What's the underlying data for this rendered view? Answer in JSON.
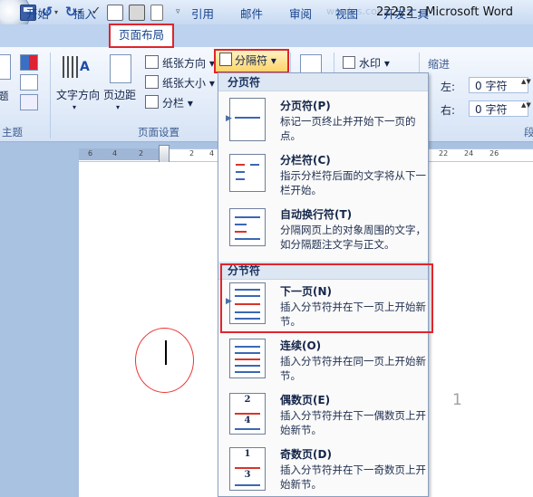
{
  "window": {
    "title": "22222 - Microsoft Word",
    "ghost_title": "wordes.com"
  },
  "quick_access": {
    "undo_glyph": "↺",
    "redo_glyph": "↻",
    "spell_glyph": "✓",
    "dropdown_glyph": "▾",
    "more_glyph": "▿"
  },
  "tabs": [
    "开始",
    "插入",
    "页面布局",
    "引用",
    "邮件",
    "审阅",
    "视图",
    "开发工具"
  ],
  "ribbon": {
    "theme_group_label": "主题",
    "theme_label_fragment": "题",
    "text_direction_label": "文字方向",
    "margins_label": "页边距",
    "orientation_label": "纸张方向",
    "size_label": "纸张大小",
    "columns_label": "分栏",
    "breaks_label": "分隔符",
    "page_setup_group_label": "页面设置",
    "watermark_label": "水印",
    "indent_title": "缩进",
    "indent_left_label": "左:",
    "indent_right_label": "右:",
    "indent_left_value": "0 字符",
    "indent_right_value": "0 字符",
    "para_label_fragment": "段",
    "dropdown_glyph": "▾",
    "spin_glyph": "▲▼"
  },
  "ruler": {
    "numbers": [
      "6",
      "4",
      "2",
      "2",
      "4",
      "22",
      "24",
      "26"
    ]
  },
  "document": {
    "page_number": "1"
  },
  "breaks_menu": {
    "page_breaks_header": "分页符",
    "section_breaks_header": "分节符",
    "arrow_glyph": "▶",
    "items": [
      {
        "title": "分页符(P)",
        "desc": "标记一页终止并开始下一页的点。"
      },
      {
        "title": "分栏符(C)",
        "desc": "指示分栏符后面的文字将从下一栏开始。"
      },
      {
        "title": "自动换行符(T)",
        "desc": "分隔网页上的对象周围的文字，如分隔题注文字与正文。"
      },
      {
        "title": "下一页(N)",
        "desc": "插入分节符并在下一页上开始新节。"
      },
      {
        "title": "连续(O)",
        "desc": "插入分节符并在同一页上开始新节。"
      },
      {
        "title": "偶数页(E)",
        "desc": "插入分节符并在下一偶数页上开始新节。",
        "thumb_numbers": [
          "2",
          "4"
        ]
      },
      {
        "title": "奇数页(D)",
        "desc": "插入分节符并在下一奇数页上开始新节。",
        "thumb_numbers": [
          "1",
          "3"
        ]
      }
    ]
  },
  "colors": {
    "highlight_red": "#e0252b",
    "accent_blue": "#3a68b4",
    "ribbon_bg": "#e3ecf9"
  }
}
